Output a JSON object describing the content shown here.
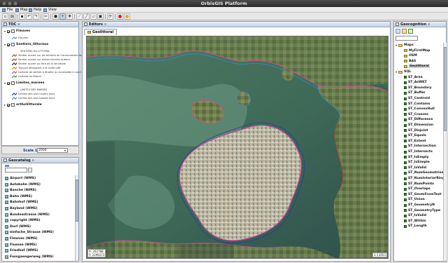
{
  "window": {
    "title": "OrbisGIS Platform"
  },
  "menu": [
    {
      "label": "File",
      "icon": "file-icon"
    },
    {
      "label": "Map",
      "icon": "map-icon"
    },
    {
      "label": "Help",
      "icon": "help-icon"
    },
    {
      "label": "View",
      "icon": "view-icon"
    }
  ],
  "toc": {
    "title": "TOC",
    "close": "x",
    "layers": [
      {
        "name": "Fleuves",
        "checked": true,
        "expanded": true,
        "legend": [
          {
            "label": "Fleuves",
            "color": "#4f8fd6"
          }
        ]
      },
      {
        "name": "Sentiers_littoraux",
        "checked": true,
        "expanded": true,
        "legend_title": "SENTIERS DU LITTORAL",
        "legend": [
          {
            "label": "Sentier ouvert sur les terrains du Conservatoire du Littoral",
            "color": "#8a5a2a"
          },
          {
            "label": "Sentier ouvert sur autres terrains publics",
            "color": "#b0482a"
          },
          {
            "label": "Sentier ouvert au titre de la servitude",
            "color": "#2a2a2a"
          },
          {
            "label": "Tronçon dérogeant à la continuité",
            "color": "#e07a1a"
          },
          {
            "label": "Linéaire de sentier à étudier ou accessible à court terme",
            "color": "#d04a9a"
          },
          {
            "label": "Linéaire du littoral",
            "color": "#3a9a3a"
          }
        ]
      },
      {
        "name": "Limites_marees",
        "checked": true,
        "expanded": true,
        "legend_title": "LIMITES DES MAREES",
        "legend": [
          {
            "label": "Limites des plus hautes eaux",
            "color": "#2a3aa0"
          },
          {
            "label": "Limites des plus basses eaux",
            "color": "#3a8ad0"
          }
        ]
      },
      {
        "name": "orthoVittorale",
        "checked": true,
        "expanded": false,
        "legend": []
      }
    ]
  },
  "scale": {
    "label": "Scale 1 :",
    "value": "2000"
  },
  "geocatalog": {
    "title": "Geocatalog",
    "search_placeholder": "",
    "items": [
      "Airport (WMS)",
      "Autobahn (WMS)",
      "Banche (WMS)",
      "Bahn (WMS)",
      "Bahnhof (WMS)",
      "Bayland (WMS)",
      "Bundesstrasse (WMS)",
      "copyright (WMS)",
      "Dorf (WMS)",
      "einfache_Strasse (WMS)",
      "Flewves (WMS)",
      "Fluesse (WMS)",
      "Friedhof (WMS)",
      "Fussgaengerweg (WMS)"
    ]
  },
  "editors": {
    "title": "Editors",
    "tab": "Geolittoral",
    "coords": [
      "X: 202788",
      "Y: 2299273"
    ],
    "scale_indicator": "1:11053"
  },
  "geocognition": {
    "title": "Geocognition",
    "search_placeholder": "",
    "maps_folder": "Maps",
    "maps": [
      "MyFirstMap",
      "OSM",
      "BAS",
      "Geolittoral"
    ],
    "selected_map": "Geolittoral",
    "sql_folder": "SQL",
    "functions": [
      "ST_Area",
      "ST_AsWKT",
      "ST_Boundary",
      "ST_Buffer",
      "ST_Centroid",
      "ST_Contains",
      "ST_ConvexHull",
      "ST_Crosses",
      "ST_Difference",
      "ST_Dimension",
      "ST_Disjoint",
      "ST_Equals",
      "ST_Extent",
      "ST_Intersection",
      "ST_Intersects",
      "ST_IsEmpty",
      "ST_IsSimple",
      "ST_IsValid",
      "ST_NumGeometries",
      "ST_NumInteriorRings",
      "ST_NumPoints",
      "ST_Overlaps",
      "ST_GeomFromText",
      "ST_Union",
      "ST_GeometryN",
      "ST_GeometryType",
      "ST_IsValid",
      "ST_Within",
      "ST_Length"
    ]
  },
  "colors": {
    "panel_border": "#8f9fb5",
    "header_top": "#e9eef6",
    "header_bottom": "#c6d2e3",
    "link_blue": "#1a3a8a"
  }
}
